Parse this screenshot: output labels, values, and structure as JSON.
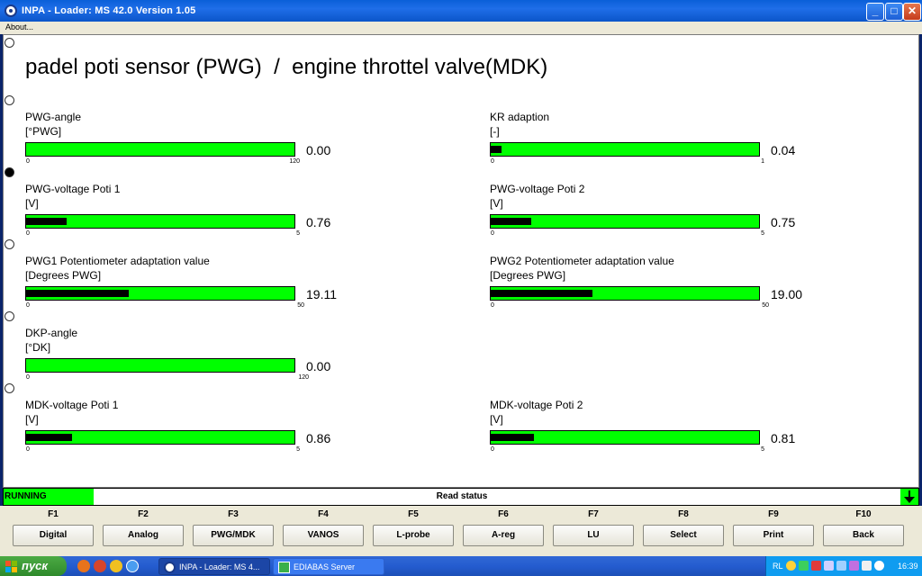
{
  "window": {
    "title": "INPA - Loader:  MS 42.0 Version 1.05",
    "minimize_glyph": "_",
    "maximize_glyph": "□",
    "close_glyph": "✕"
  },
  "menu": {
    "items": [
      "About..."
    ]
  },
  "main": {
    "title": "padel poti sensor (PWG)  /  engine throttel valve(MDK)",
    "gauges": [
      {
        "label": "PWG-angle",
        "unit": "[°PWG]",
        "value": "0.00",
        "min": "0",
        "max": "120",
        "fill_fraction": 0.0
      },
      {
        "label": "KR adaption",
        "unit": "[-]",
        "value": "0.04",
        "min": "0",
        "max": "1",
        "fill_fraction": 0.04
      },
      {
        "label": "PWG-voltage Poti 1",
        "unit": "[V]",
        "value": "0.76",
        "min": "0",
        "max": "5",
        "fill_fraction": 0.152
      },
      {
        "label": "PWG-voltage Poti 2",
        "unit": "[V]",
        "value": "0.75",
        "min": "0",
        "max": "5",
        "fill_fraction": 0.15
      },
      {
        "label": "PWG1 Potentiometer adaptation value",
        "unit": "[Degrees PWG]",
        "value": "19.11",
        "min": "0",
        "max": "50",
        "fill_fraction": 0.3822
      },
      {
        "label": "PWG2 Potentiometer adaptation value",
        "unit": "[Degrees PWG]",
        "value": "19.00",
        "min": "0",
        "max": "50",
        "fill_fraction": 0.38
      },
      {
        "label": "DKP-angle",
        "unit": "[°DK]",
        "value": "0.00",
        "min": "0",
        "max": "120",
        "fill_fraction": 0.0
      },
      {
        "label": "MDK-voltage Poti 1",
        "unit": "[V]",
        "value": "0.86",
        "min": "0",
        "max": "5",
        "fill_fraction": 0.172
      },
      {
        "label": "MDK-voltage Poti 2",
        "unit": "[V]",
        "value": "0.81",
        "min": "0",
        "max": "5",
        "fill_fraction": 0.162
      }
    ]
  },
  "status": {
    "state": "RUNNING",
    "message": "Read status"
  },
  "function_keys": [
    {
      "key": "F1",
      "label": "Digital"
    },
    {
      "key": "F2",
      "label": "Analog"
    },
    {
      "key": "F3",
      "label": "PWG/MDK"
    },
    {
      "key": "F4",
      "label": "VANOS"
    },
    {
      "key": "F5",
      "label": "L-probe"
    },
    {
      "key": "F6",
      "label": "A-reg"
    },
    {
      "key": "F7",
      "label": "LU"
    },
    {
      "key": "F8",
      "label": "Select"
    },
    {
      "key": "F9",
      "label": "Print"
    },
    {
      "key": "F10",
      "label": "Back"
    }
  ],
  "taskbar": {
    "start_label": "пуск",
    "tasks": [
      {
        "label": "INPA - Loader:  MS 4...",
        "active": true
      },
      {
        "label": "EDIABAS Server",
        "active": false
      }
    ],
    "tray": {
      "language": "RL",
      "clock": "16:39"
    }
  },
  "colors": {
    "gauge_bar": "#00ff00",
    "gauge_fill": "#000000",
    "status_running": "#00ff00"
  }
}
